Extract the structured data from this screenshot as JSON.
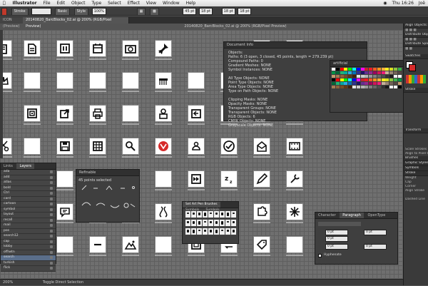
{
  "menubar": {
    "app": "Illustrator",
    "items": [
      "File",
      "Edit",
      "Object",
      "Type",
      "Select",
      "Effect",
      "View",
      "Window",
      "Help"
    ],
    "time": "Thu 16:26",
    "user": "Joë"
  },
  "controlbar": {
    "stroke_label": "Stroke",
    "basic_label": "Basic",
    "style_label": "Style",
    "opacity": "100%",
    "x": "45 pt",
    "y": "18 pt",
    "w": "18 pt",
    "h": "18 pt"
  },
  "tabs": {
    "tab1": "ICON (Preview)",
    "tab2": "20140820_BarcBlocks_02.ai @ 200% (RGB/Pixel Preview)"
  },
  "title": "20140820_BarcBlocks_02.ai @ 200% (RGB/Pixel Preview)",
  "docinfo": {
    "title": "Document Info",
    "objects": "Objects:",
    "lines": [
      "Paths: 6 (3 open, 3 closed, 45 points, length = 279.239 pt)",
      "Compound Paths: 0",
      "Gradient Meshes: NONE",
      "Symbol Instances: NONE",
      "",
      "All Type Objects: NONE",
      "Point Type Objects: NONE",
      "Area Type Objects: NONE",
      "Type on Path Objects: NONE",
      "",
      "Clipping Masks: NONE",
      "Opacity Masks: NONE",
      "Transparent Groups: NONE",
      "Transparent Objects: NONE",
      "RGB Objects: 6",
      "CMYK Objects: NONE",
      "Grayscale Objects: NONE"
    ]
  },
  "swatches_title": "artificial",
  "layers": {
    "tab_links": "Links",
    "tab_layers": "Layers",
    "rows": [
      "ada",
      "add",
      "atlas",
      "bold",
      "Ctrl",
      "card",
      "cartoon",
      "symbol",
      "layout",
      "recall",
      "mail",
      "pos",
      "search12",
      "cap",
      "lobby",
      "off/wtn",
      "search",
      "turkish",
      "flick"
    ]
  },
  "refine": {
    "title": "Refinable",
    "status": "45 points selected"
  },
  "glyphs": {
    "tab1": "Set Art Pen Brushes",
    "tab2": "Symbols",
    "tab3": "Symbols"
  },
  "para": {
    "tab1": "Character",
    "tab2": "Paragraph",
    "tab3": "OpenType",
    "f1": "0 pt",
    "f2": "0 pt",
    "f3": "0 pt",
    "f4": "0 pt",
    "f5": "0 pt",
    "hyphenate": "Hyphenate"
  },
  "rdock": {
    "align": "Align Objects:",
    "distribute": "Distribute Objects:",
    "spacing": "Distribute Spacing:",
    "swatches": "Swatches",
    "stroke": "Stroke",
    "transform": "Transform",
    "scale": "Scale Strokes & Effects",
    "align_pixel": "Align to Pixel Grid",
    "brushes": "Brushes",
    "graphic": "Graphic Styles",
    "symbols": "Symbols",
    "stroke2": "Stroke",
    "weight": "Weight",
    "cap": "Cap",
    "corner": "Corner",
    "align_stroke": "Align Stroke",
    "dashed": "Dashed Line"
  },
  "status": {
    "zoom": "200%",
    "tool": "Toggle Direct Selection"
  },
  "colors": {
    "panel": "#3f3f3f",
    "canvas": "#6f6f6f",
    "accent": "#d62a2a"
  }
}
